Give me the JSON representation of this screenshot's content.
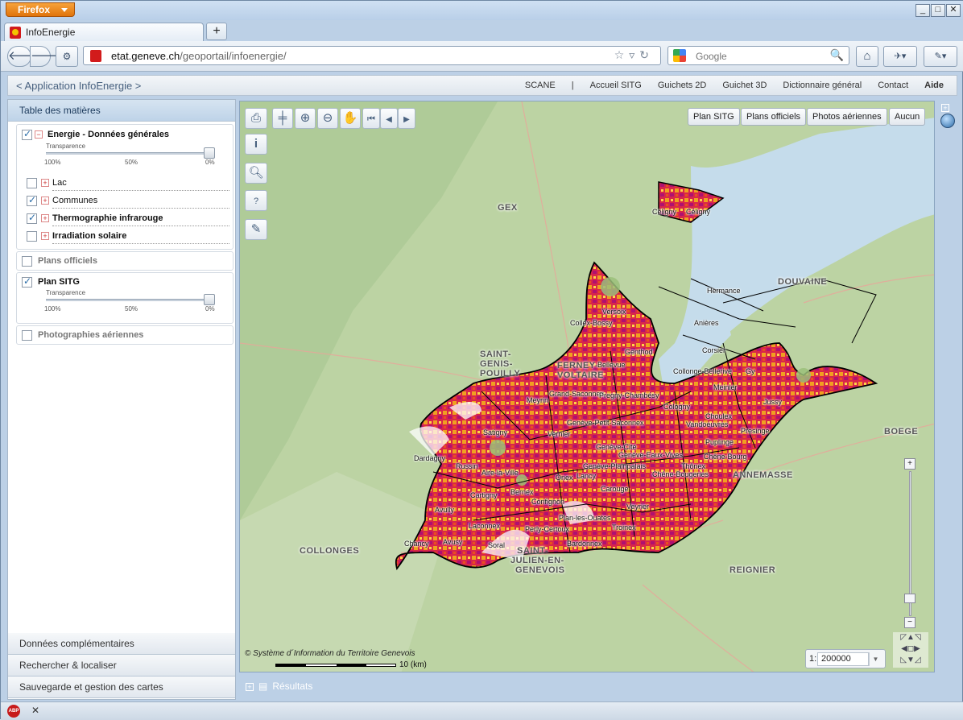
{
  "browser": {
    "menu_button": "Firefox",
    "tab_title": "InfoEnergie",
    "url_domain": "etat.geneve.ch",
    "url_path": "/geoportail/infoenergie/",
    "search_placeholder": "Google",
    "win_min": "_",
    "win_max": "□",
    "win_close": "✕",
    "newtab": "+"
  },
  "app": {
    "title": "< Application InfoEnergie >",
    "menu": [
      "SCANE",
      "|",
      "Accueil SITG",
      "Guichets 2D",
      "Guichet 3D",
      "Dictionnaire général",
      "Contact",
      "Aide"
    ]
  },
  "sidebar": {
    "toc_title": "Table des matières",
    "groups": [
      {
        "label": "Energie - Données générales",
        "checked": true,
        "transparency_label": "Transparence",
        "ticks": [
          "100%",
          "50%",
          "0%"
        ],
        "transparency_value": 0,
        "children": [
          {
            "label": "Lac",
            "checked": false
          },
          {
            "label": "Communes",
            "checked": true
          },
          {
            "label": "Thermographie infrarouge",
            "checked": true
          },
          {
            "label": "Irradiation solaire",
            "checked": false
          }
        ]
      },
      {
        "label": "Plans officiels",
        "checked": false
      },
      {
        "label": "Plan SITG",
        "checked": true,
        "transparency_label": "Transparence",
        "ticks": [
          "100%",
          "50%",
          "0%"
        ],
        "transparency_value": 0
      },
      {
        "label": "Photographies aériennes",
        "checked": false
      }
    ],
    "bottom_sections": [
      "Données complémentaires",
      "Rechercher & localiser",
      "Sauvegarde et gestion des cartes"
    ]
  },
  "map": {
    "basemap_buttons": [
      "Plan SITG",
      "Plans officiels",
      "Photos aériennes",
      "Aucun"
    ],
    "copyright": "© Système d´Information du Territoire Genevois",
    "scale_bar_label": "10 (km)",
    "scale_prefix": "1:",
    "scale_value": "200000",
    "results_label": "Résultats",
    "region_labels": [
      "GEX",
      "DOUVAINE",
      "SAINT-",
      "GENIS-",
      "POUILLY",
      "FERNEY-",
      "VOLTAIRE",
      "BOEGE",
      "ANNEMASSE",
      "COLLONGES",
      "SAINT-",
      "JULIEN-EN-",
      "GENEVOIS",
      "REIGNIER"
    ],
    "commune_labels": [
      "Céligny",
      "Céligny",
      "Hermance",
      "Versoix",
      "Collex-Bossy",
      "Anières",
      "Genthod",
      "Corsier",
      "Bellevue",
      "Collonge-Bellerive",
      "Gy",
      "Meinier",
      "Jussy",
      "Grand-Saconnex",
      "Pregny-Chambésy",
      "Meyrin",
      "Cologny",
      "Choulex",
      "Vandoeuvres",
      "Presinge",
      "Genève-Petit-Saconnex",
      "Satigny",
      "Vernier",
      "Puplinge",
      "Genève-Cité",
      "Chêne-Bourg",
      "Genève-Eaux-Vives",
      "Dardagny",
      "Russin",
      "Aire-la-Ville",
      "Genève-Plainpalais",
      "Thônex",
      "Onex",
      "Lancy",
      "Chêne-Bougeries",
      "Cartigny",
      "Bernex",
      "Carouge",
      "Confignon",
      "Veyrier",
      "Avully",
      "Plan-les-Ouates",
      "Laconnex",
      "Perly-Certoux",
      "Troinex",
      "Chancy",
      "Avusy",
      "Soral",
      "Bardonnex"
    ]
  }
}
